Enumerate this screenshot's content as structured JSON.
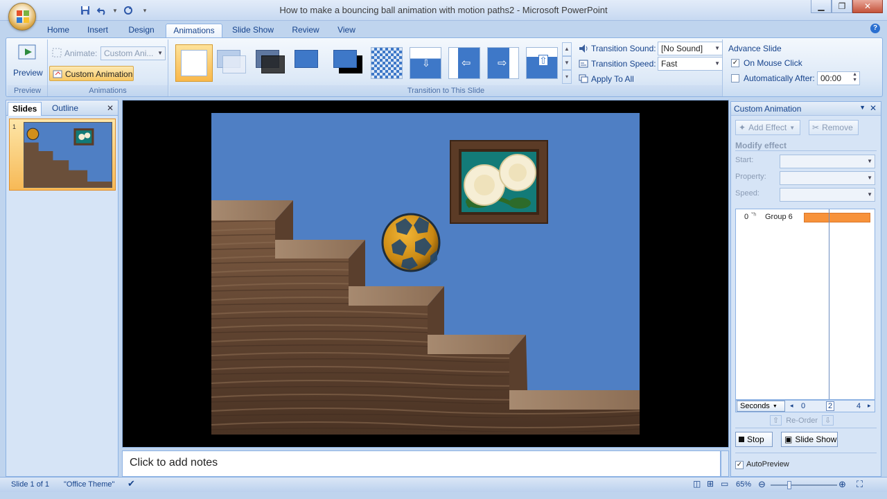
{
  "window": {
    "title": "How to make a bouncing ball animation with motion paths2 - Microsoft PowerPoint"
  },
  "tabs": [
    "Home",
    "Insert",
    "Design",
    "Animations",
    "Slide Show",
    "Review",
    "View"
  ],
  "active_tab": "Animations",
  "ribbon": {
    "preview_label": "Preview",
    "preview_group": "Preview",
    "animate_label": "Animate:",
    "animate_value": "Custom Ani...",
    "custom_animation_label": "Custom Animation",
    "animations_group": "Animations",
    "transition_group": "Transition to This Slide",
    "transition_sound_label": "Transition Sound:",
    "transition_sound_value": "[No Sound]",
    "transition_speed_label": "Transition Speed:",
    "transition_speed_value": "Fast",
    "apply_to_all_label": "Apply To All",
    "advance_slide_label": "Advance Slide",
    "on_mouse_click_label": "On Mouse Click",
    "on_mouse_click_checked": true,
    "auto_after_label": "Automatically After:",
    "auto_after_checked": false,
    "auto_after_value": "00:00"
  },
  "slides_pane": {
    "tab_slides": "Slides",
    "tab_outline": "Outline",
    "slide_number": "1"
  },
  "notes": {
    "placeholder": "Click to add notes"
  },
  "custom_animation": {
    "title": "Custom Animation",
    "add_effect": "Add Effect",
    "remove": "Remove",
    "modify_effect": "Modify effect",
    "start_label": "Start:",
    "property_label": "Property:",
    "speed_label": "Speed:",
    "items": [
      {
        "index": "0",
        "name": "Group 6"
      }
    ],
    "timeline_unit": "Seconds",
    "timeline_ticks": [
      "0",
      "2",
      "4"
    ],
    "reorder_label": "Re-Order",
    "stop_label": "Stop",
    "slide_show_label": "Slide Show",
    "autopreview_label": "AutoPreview",
    "autopreview_checked": true
  },
  "status": {
    "slide_info": "Slide 1 of 1",
    "theme": "\"Office Theme\"",
    "zoom": "65%"
  },
  "colors": {
    "slide_background": "#4f7fc4",
    "timeline_bar": "#f7923a",
    "selection_orange": "#f7b956"
  }
}
